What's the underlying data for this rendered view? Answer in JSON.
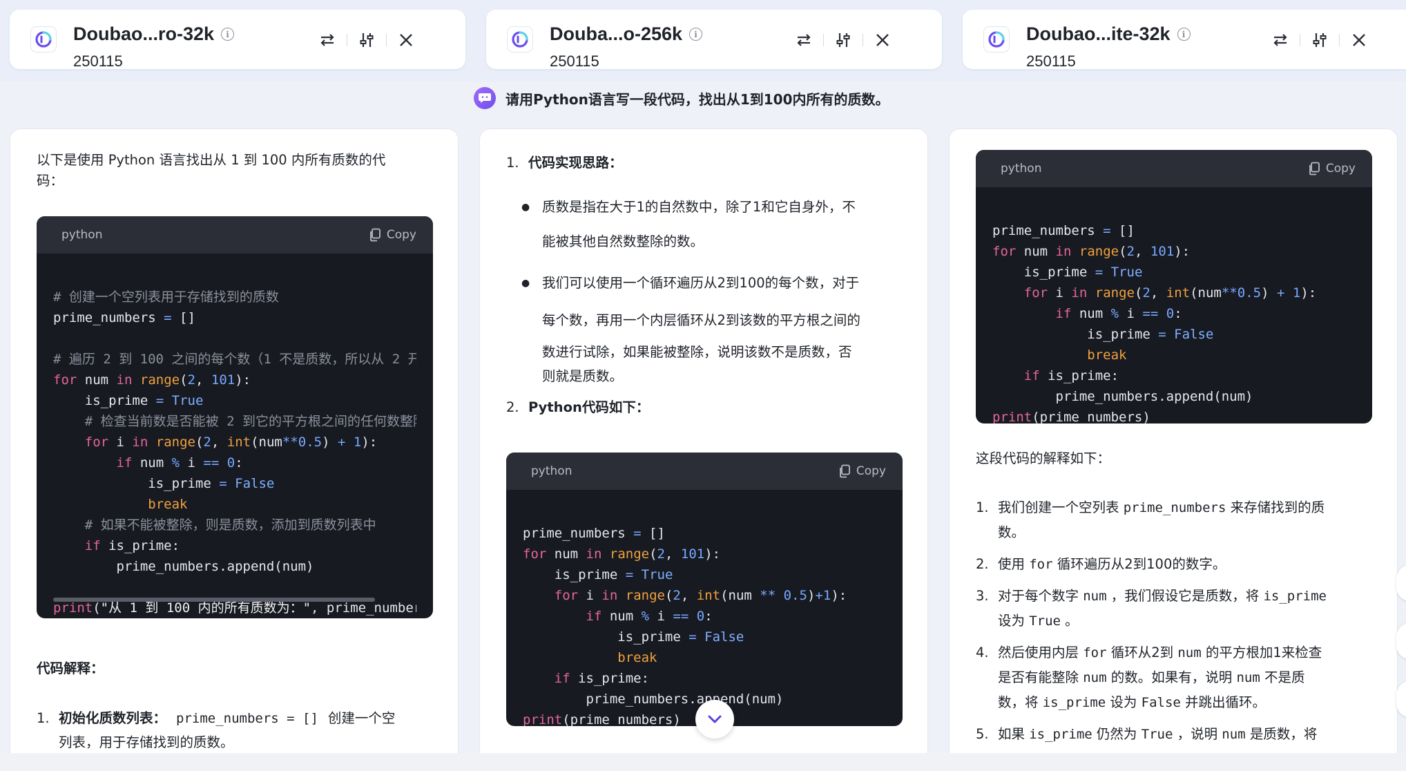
{
  "models": [
    {
      "name": "Doubao...ro-32k",
      "version": "250115"
    },
    {
      "name": "Douba...o-256k",
      "version": "250115"
    },
    {
      "name": "Doubao...ite-32k",
      "version": "250115"
    }
  ],
  "prompt": "请用Python语言写一段代码，找出从1到100内所有的质数。",
  "panel1": {
    "intro": "以下是使用 Python 语言找出从 1 到 100 内所有质数的代码：",
    "intro_line1": "以下是使用 Python 语言找出从 1 到 100 内所有质数的代",
    "intro_line2": "码：",
    "code_lang": "python",
    "copy_label": "Copy",
    "explain_title": "代码解释：",
    "item1_num": "1.",
    "item1_title": "初始化质数列表：",
    "item1_code": "prime_numbers = []",
    "item1_text": "创建一个空",
    "item1_text2": "列表，用于存储找到的质数。"
  },
  "panel2": {
    "step1_num": "1.",
    "step1_title": "代码实现思路：",
    "bullet1_line1": "质数是指在大于1的自然数中，除了1和它自身外，不",
    "bullet1_line2": "能被其他自然数整除的数。",
    "bullet2_line1": "我们可以使用一个循环遍历从2到100的每个数，对于",
    "bullet2_line2": "每个数，再用一个内层循环从2到该数的平方根之间的",
    "bullet2_line3": "数进行试除，如果能被整除，说明该数不是质数，否",
    "bullet2_line4": "则就是质数。",
    "step2_num": "2.",
    "step2_title": "Python代码如下：",
    "code_lang": "python",
    "copy_label": "Copy"
  },
  "panel3": {
    "code_lang": "python",
    "copy_label": "Copy",
    "explain_intro": "这段代码的解释如下：",
    "items": [
      {
        "num": "1.",
        "l1": [
          "我们创建一个空列表 ",
          "prime_numbers",
          " 来存储找到的质"
        ],
        "l2": [
          "数。"
        ]
      },
      {
        "num": "2.",
        "l1": [
          "使用 ",
          "for",
          " 循环遍历从2到100的数字。"
        ],
        "l2": []
      },
      {
        "num": "3.",
        "l1": [
          "对于每个数字 ",
          "num",
          " ，我们假设它是质数，将 ",
          "is_prime"
        ],
        "l2": [
          "设为 ",
          "True",
          " 。"
        ]
      },
      {
        "num": "4.",
        "l1": [
          "然后使用内层 ",
          "for",
          " 循环从2到 ",
          "num",
          " 的平方根加1来检查"
        ],
        "l2": [
          "是否有能整除 ",
          "num",
          " 的数。如果有，说明 ",
          "num",
          " 不是质"
        ],
        "l3": [
          "数，将 ",
          "is_prime",
          " 设为 ",
          "False",
          " 并跳出循环。"
        ]
      },
      {
        "num": "5.",
        "l1": [
          "如果 ",
          "is_prime",
          " 仍然为 ",
          "True",
          " ，说明 ",
          "num",
          " 是质数，将"
        ],
        "l2": []
      }
    ]
  }
}
